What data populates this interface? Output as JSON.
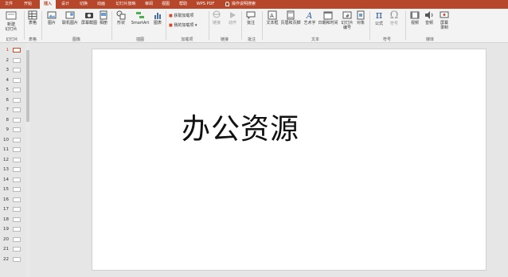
{
  "tabs": [
    {
      "label": "文件"
    },
    {
      "label": "开始"
    },
    {
      "label": "插入",
      "active": true
    },
    {
      "label": "设计"
    },
    {
      "label": "切换"
    },
    {
      "label": "动画"
    },
    {
      "label": "幻灯片放映"
    },
    {
      "label": "审阅"
    },
    {
      "label": "视图"
    },
    {
      "label": "帮助"
    },
    {
      "label": "WPS PDF"
    }
  ],
  "tell_me": "操作说明搜索",
  "ribbon": {
    "new_slide": "新建\n幻灯片",
    "table": "表格",
    "picture": "图片",
    "online_picture": "联机图片",
    "screenshot": "屏幕截图",
    "album": "相册",
    "shapes": "形状",
    "smartart": "SmartArt",
    "chart": "图表",
    "get_addins": "获取加载项",
    "my_addins": "我的加载项",
    "link": "链接",
    "action": "动作",
    "comment": "批注",
    "textbox": "文本框",
    "header_footer": "页眉和页脚",
    "wordart": "艺术字",
    "date_time": "日期和时间",
    "slide_number": "幻灯片\n编号",
    "object": "对象",
    "equation": "公式",
    "symbol": "符号",
    "video": "视频",
    "audio": "音频",
    "screen_record": "屏幕\n录制",
    "groups": {
      "slides": "幻灯片",
      "tables": "表格",
      "images": "图像",
      "illustrations": "插图",
      "addins": "加载项",
      "links": "链接",
      "comments": "批注",
      "text": "文本",
      "symbols": "符号",
      "media": "媒体"
    }
  },
  "thumbnails": [
    {
      "num": "1",
      "selected": true
    },
    {
      "num": "2"
    },
    {
      "num": "3"
    },
    {
      "num": "4"
    },
    {
      "num": "5"
    },
    {
      "num": "6"
    },
    {
      "num": "7"
    },
    {
      "num": "8"
    },
    {
      "num": "9"
    },
    {
      "num": "10"
    },
    {
      "num": "11"
    },
    {
      "num": "12"
    },
    {
      "num": "13"
    },
    {
      "num": "14"
    },
    {
      "num": "15"
    },
    {
      "num": "16"
    },
    {
      "num": "17"
    },
    {
      "num": "18"
    },
    {
      "num": "19"
    },
    {
      "num": "20"
    },
    {
      "num": "21"
    },
    {
      "num": "22"
    }
  ],
  "slide": {
    "title": "办公资源"
  },
  "colors": {
    "accent": "#b7472a",
    "selected_border": "#d24726"
  }
}
